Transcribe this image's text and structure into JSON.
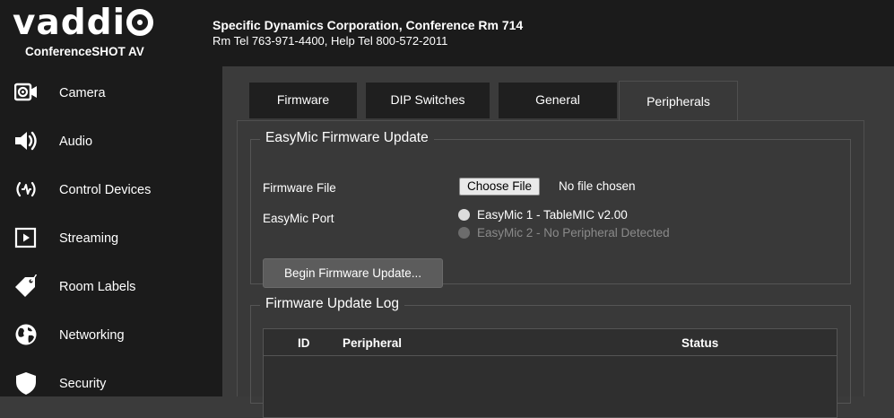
{
  "header": {
    "logo_text": "vaddi",
    "product": "ConferenceSHOT AV",
    "room_name": "Specific Dynamics Corporation, Conference Rm 714",
    "room_tel": "Rm Tel 763-971-4400, Help Tel 800-572-2011"
  },
  "sidebar": {
    "items": [
      {
        "label": "Camera",
        "icon": "camera-icon"
      },
      {
        "label": "Audio",
        "icon": "speaker-icon"
      },
      {
        "label": "Control Devices",
        "icon": "control-devices-icon"
      },
      {
        "label": "Streaming",
        "icon": "play-icon"
      },
      {
        "label": "Room Labels",
        "icon": "tag-icon"
      },
      {
        "label": "Networking",
        "icon": "globe-icon"
      },
      {
        "label": "Security",
        "icon": "shield-icon"
      }
    ]
  },
  "tabs": [
    {
      "label": "Firmware",
      "active": false
    },
    {
      "label": "DIP Switches",
      "active": false
    },
    {
      "label": "General",
      "active": false
    },
    {
      "label": "Peripherals",
      "active": true
    }
  ],
  "easymic": {
    "legend": "EasyMic Firmware Update",
    "firmware_file_label": "Firmware File",
    "choose_file_label": "Choose File",
    "no_file_text": "No file chosen",
    "port_label": "EasyMic Port",
    "ports": [
      {
        "label": "EasyMic 1 - TableMIC v2.00",
        "enabled": true
      },
      {
        "label": "EasyMic 2 - No Peripheral Detected",
        "enabled": false
      }
    ],
    "begin_button": "Begin Firmware Update..."
  },
  "log": {
    "legend": "Firmware Update Log",
    "columns": [
      "ID",
      "Peripheral",
      "Status"
    ]
  }
}
